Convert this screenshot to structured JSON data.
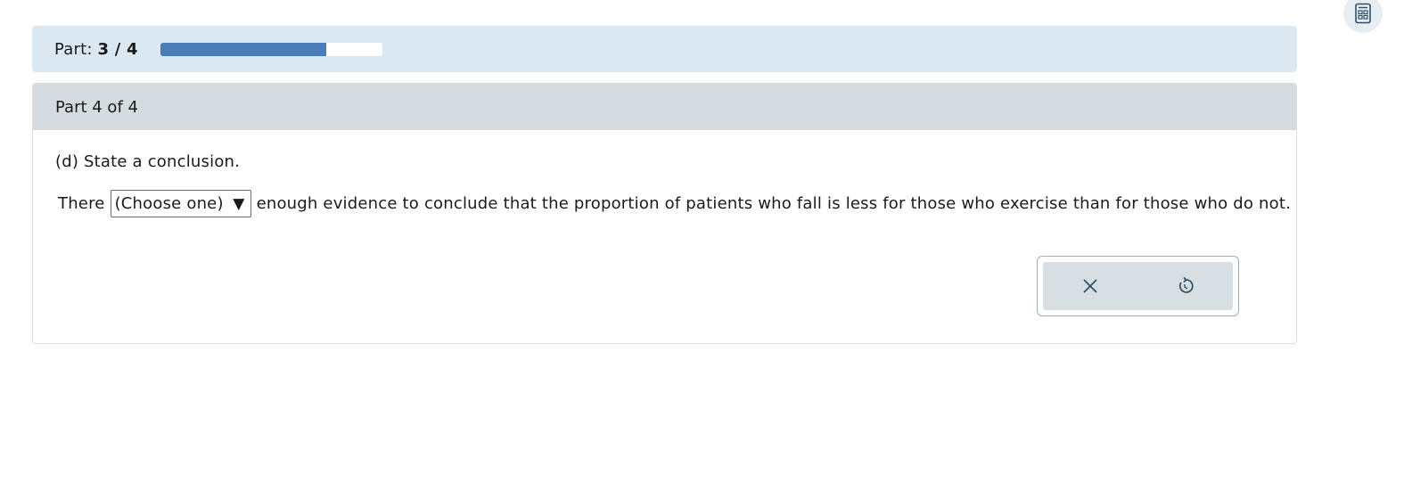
{
  "progress": {
    "label_prefix": "Part: ",
    "label_value": "3 / 4",
    "fraction": 0.75,
    "fill_color": "#4a7db8"
  },
  "part": {
    "header": "Part 4 of 4",
    "prompt": "(d) State a conclusion.",
    "sentence_before": "There",
    "select_value": "(Choose one)",
    "select_caret": "▼",
    "sentence_after": "enough evidence to conclude that the proportion of patients who fall is less for those who exercise than for those who do not."
  },
  "icons": {
    "calculator": "calculator-icon",
    "clear": "close-icon",
    "undo": "undo-icon"
  }
}
